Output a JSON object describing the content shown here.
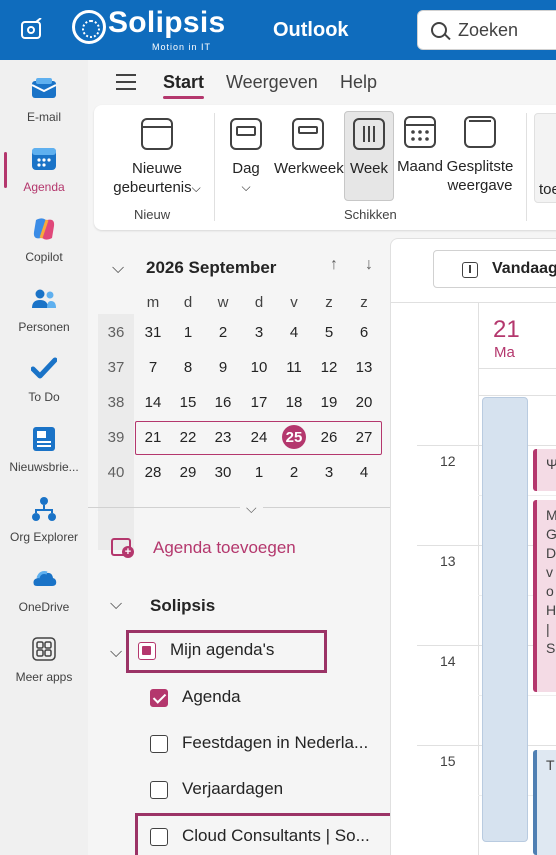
{
  "topbar": {
    "brand": "Solipsis",
    "tagline": "Motion in IT",
    "app_title": "Outlook",
    "search": {
      "placeholder": "Zoeken",
      "value": ""
    }
  },
  "rail": [
    {
      "label": "E-mail",
      "icon": "mail-icon"
    },
    {
      "label": "Agenda",
      "icon": "calendar-icon",
      "active": true
    },
    {
      "label": "Copilot",
      "icon": "copilot-icon"
    },
    {
      "label": "Personen",
      "icon": "people-icon"
    },
    {
      "label": "To Do",
      "icon": "todo-check-icon"
    },
    {
      "label": "Nieuwsbrie...",
      "icon": "newsletter-icon"
    },
    {
      "label": "Org Explorer",
      "icon": "org-explorer-icon"
    },
    {
      "label": "OneDrive",
      "icon": "onedrive-cloud-icon"
    },
    {
      "label": "Meer apps",
      "icon": "more-apps-icon"
    }
  ],
  "tabs": {
    "start": "Start",
    "weergeven": "Weergeven",
    "help": "Help"
  },
  "ribbon": {
    "nieuw": {
      "line1": "Nieuwe",
      "line2": "gebeurtenis",
      "chevron": "⌵",
      "group": "Nieuw"
    },
    "schikken": {
      "dag": "Dag",
      "dag_chevron": "⌵",
      "werkweek": "Werkweek",
      "week": "Week",
      "maand": "Maand",
      "split1": "Gesplitste",
      "split2": "weergave",
      "group": "Schikken"
    },
    "partial_label": "toe"
  },
  "minical": {
    "title": "2026 September",
    "nav_up": "↑",
    "nav_down": "↓",
    "collapse_chevron": "⌵",
    "weekdays": [
      "m",
      "d",
      "w",
      "d",
      "v",
      "z",
      "z"
    ],
    "weeks": [
      {
        "wk": "36",
        "days": [
          "31",
          "1",
          "2",
          "3",
          "4",
          "5",
          "6"
        ]
      },
      {
        "wk": "37",
        "days": [
          "7",
          "8",
          "9",
          "10",
          "11",
          "12",
          "13"
        ]
      },
      {
        "wk": "38",
        "days": [
          "14",
          "15",
          "16",
          "17",
          "18",
          "19",
          "20"
        ]
      },
      {
        "wk": "39",
        "days": [
          "21",
          "22",
          "23",
          "24",
          "25",
          "26",
          "27"
        ]
      },
      {
        "wk": "40",
        "days": [
          "28",
          "29",
          "30",
          "1",
          "2",
          "3",
          "4"
        ]
      }
    ],
    "today": "25"
  },
  "expand_chevron": "⌵",
  "calendars": {
    "add_label": "Agenda toevoegen",
    "group_name": "Solipsis",
    "group_chevron": "⌵",
    "my_cals_label": "Mijn agenda's",
    "my_cals_chevron": "⌵",
    "items": [
      {
        "label": "Agenda",
        "checked": true
      },
      {
        "label": "Feestdagen in Nederla...",
        "checked": false
      },
      {
        "label": "Verjaardagen",
        "checked": false
      },
      {
        "label": "Cloud Consultants | So...",
        "checked": false
      }
    ]
  },
  "calendar_view": {
    "today_button": "Vandaag",
    "day_number": "21",
    "day_name": "Ma",
    "hours": [
      "12",
      "13",
      "14",
      "15"
    ],
    "events": [
      {
        "text": "Ψ"
      },
      {
        "text": "M\nG\nD\nv\no\nH\n|\nS"
      },
      {
        "text": "T"
      }
    ]
  },
  "colors": {
    "brand_blue": "#0f6cbd",
    "accent": "#b4376d",
    "highlight_box": "#9b3366"
  }
}
